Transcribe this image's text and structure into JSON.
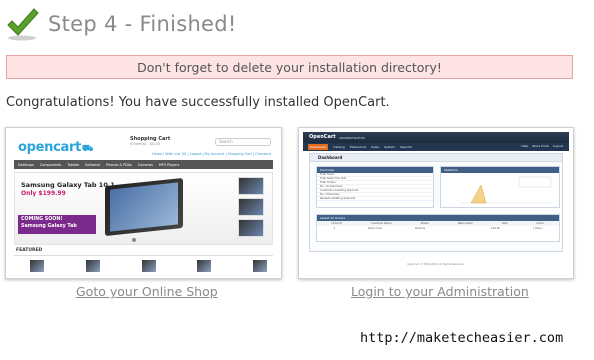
{
  "header": {
    "icon": "check-icon",
    "title": "Step 4 - Finished!"
  },
  "warning": {
    "text": "Don't forget to delete your installation directory!"
  },
  "congrats": "Congratulations! You have successfully installed OpenCart.",
  "shop_preview": {
    "logo": "opencart",
    "cart_title": "Shopping Cart",
    "cart_sub": "0 item(s) - $0.00",
    "search_placeholder": "Search",
    "toplinks": "Home | Wish List (0) | Logout | My Account | Shopping Cart | Checkout",
    "nav": [
      "Desktops",
      "Components",
      "Tablets",
      "Software",
      "Phones & PDAs",
      "Cameras",
      "MP3 Players"
    ],
    "banner_title": "Samsung Galaxy Tab 10.1",
    "banner_price": "Only $199.99",
    "banner_strip_a": "COMING SOON!",
    "banner_strip_b": "Samsung Galaxy Tab",
    "featured": "FEATURED"
  },
  "admin_preview": {
    "brand": "OpenCart",
    "brand_sub": "ADMINISTRATION",
    "nav": [
      "Dashboard",
      "Catalog",
      "Extensions",
      "Sales",
      "System",
      "Reports"
    ],
    "nav_right": [
      "Help",
      "Store Front",
      "Logout"
    ],
    "page_title": "Dashboard",
    "overview_title": "Overview",
    "overview_lines": [
      "Total Sales:",
      "Total Sales This Year:",
      "Total Orders:",
      "No. of Customers:",
      "Customers Awaiting Approval:",
      "No. of Reviews:",
      "Reviews Awaiting Approval:"
    ],
    "stats_title": "Statistics",
    "latest_title": "Latest 10 Orders",
    "latest_cols": [
      "Order ID",
      "Customer Name",
      "Status",
      "Date Added",
      "Total",
      "Action"
    ],
    "latest_row": [
      "1",
      "Demo User",
      "Pending",
      "",
      "$10.00",
      "[ View ]"
    ],
    "footer": "OpenCart © 2009-2012 All Rights Reserved."
  },
  "links": {
    "shop": "Goto your Online Shop",
    "admin": "Login to your Administration"
  },
  "watermark": "http://maketecheasier.com",
  "colors": {
    "check": "#5aa02c",
    "warning_bg": "#fde3e3",
    "warning_border": "#e8a0a0",
    "title": "#8a8a8a",
    "link": "#8a8a8a"
  }
}
